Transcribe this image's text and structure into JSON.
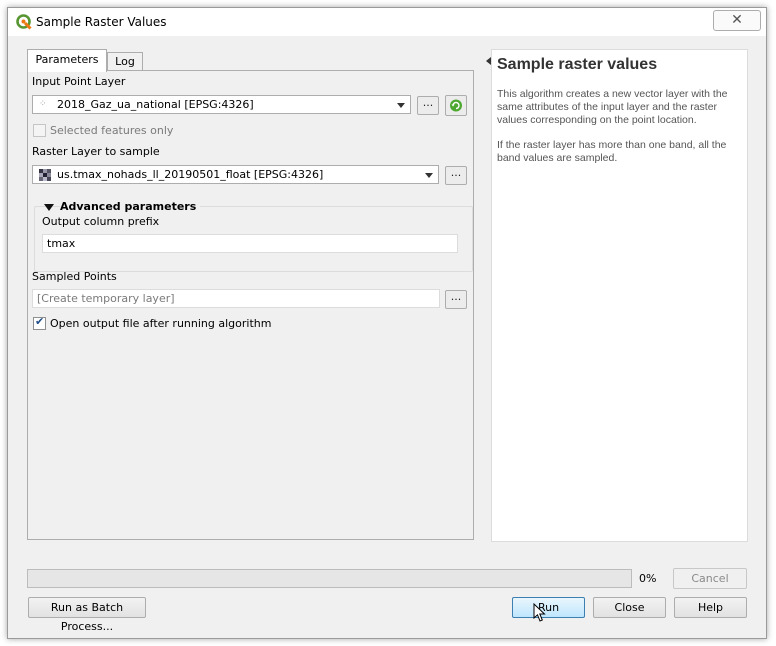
{
  "window": {
    "title": "Sample Raster Values",
    "close_glyph": "✕"
  },
  "tabs": {
    "parameters": "Parameters",
    "log": "Log"
  },
  "params": {
    "input_point_layer_label": "Input Point Layer",
    "input_point_layer_value": "2018_Gaz_ua_national [EPSG:4326]",
    "browse_glyph": "...",
    "selected_only_label": "Selected features only",
    "selected_only_checked": false,
    "raster_layer_label": "Raster Layer to sample",
    "raster_layer_value": "us.tmax_nohads_ll_20190501_float [EPSG:4326]",
    "advanced_title": "Advanced parameters",
    "prefix_label": "Output column prefix",
    "prefix_value": "tmax",
    "sampled_points_label": "Sampled Points",
    "sampled_points_placeholder": "[Create temporary layer]",
    "open_output_label": "Open output file after running algorithm",
    "open_output_checked": true
  },
  "help": {
    "title": "Sample raster values",
    "p1": "This algorithm creates a new vector layer with the same attributes of the input layer and the raster values corresponding on the point location.",
    "p2": "If the raster layer has more than one band, all the band values are sampled."
  },
  "progress": {
    "value": 0,
    "label": "0%"
  },
  "buttons": {
    "cancel": "Cancel",
    "batch": "Run as Batch Process...",
    "run": "Run",
    "close": "Close",
    "help": "Help"
  },
  "colors": {
    "progress_fill": "#06b025",
    "default_button": "#3c7fb1"
  }
}
